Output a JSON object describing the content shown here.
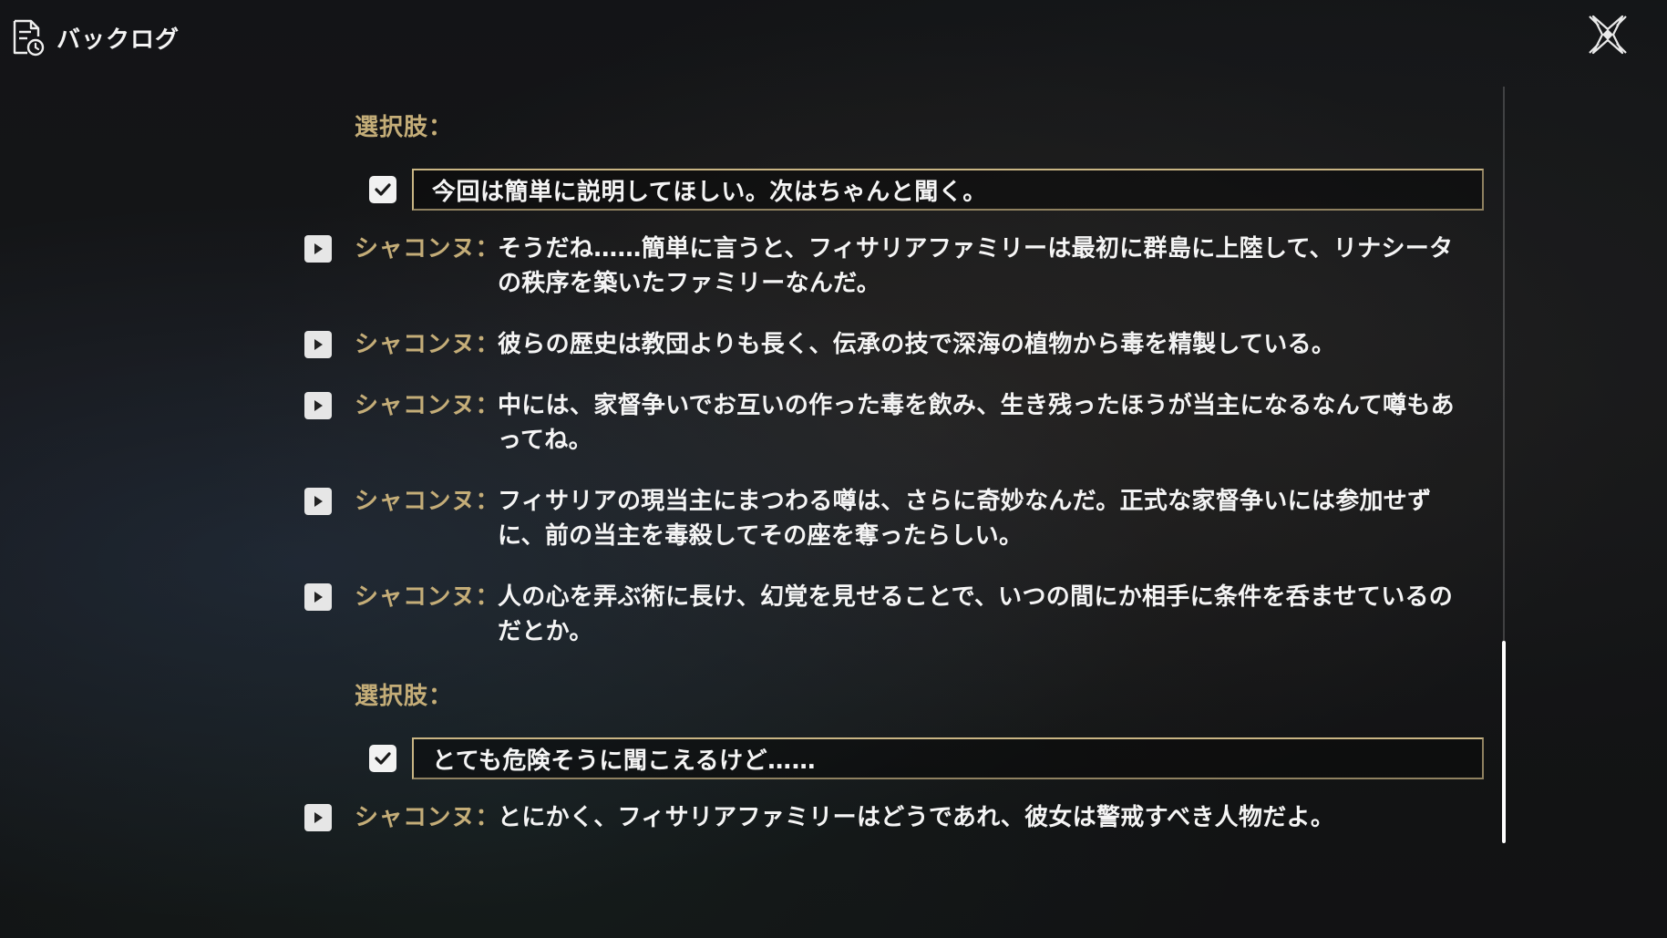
{
  "header": {
    "title": "バックログ",
    "icon": "document-history-icon"
  },
  "close_button": {
    "icon": "close-x-icon"
  },
  "colors": {
    "accent_gold": "#c4ad78",
    "text": "#f5f5f5"
  },
  "entries": [
    {
      "type": "choice",
      "header": "選択肢：",
      "text": "今回は簡単に説明してほしい。次はちゃんと聞く。"
    },
    {
      "type": "line",
      "speaker": "シャコンヌ：",
      "text": "そうだね……簡単に言うと、フィサリアファミリーは最初に群島に上陸して、リナシータの秩序を築いたファミリーなんだ。"
    },
    {
      "type": "line",
      "speaker": "シャコンヌ：",
      "text": "彼らの歴史は教団よりも長く、伝承の技で深海の植物から毒を精製している。"
    },
    {
      "type": "line",
      "speaker": "シャコンヌ：",
      "text": "中には、家督争いでお互いの作った毒を飲み、生き残ったほうが当主になるなんて噂もあってね。"
    },
    {
      "type": "line",
      "speaker": "シャコンヌ：",
      "text": "フィサリアの現当主にまつわる噂は、さらに奇妙なんだ。正式な家督争いには参加せずに、前の当主を毒殺してその座を奪ったらしい。"
    },
    {
      "type": "line",
      "speaker": "シャコンヌ：",
      "text": "人の心を弄ぶ術に長け、幻覚を見せることで、いつの間にか相手に条件を呑ませているのだとか。"
    },
    {
      "type": "choice",
      "header": "選択肢：",
      "text": "とても危険そうに聞こえるけど……"
    },
    {
      "type": "line",
      "speaker": "シャコンヌ：",
      "text": "とにかく、フィサリアファミリーはどうであれ、彼女は警戒すべき人物だよ。"
    }
  ]
}
